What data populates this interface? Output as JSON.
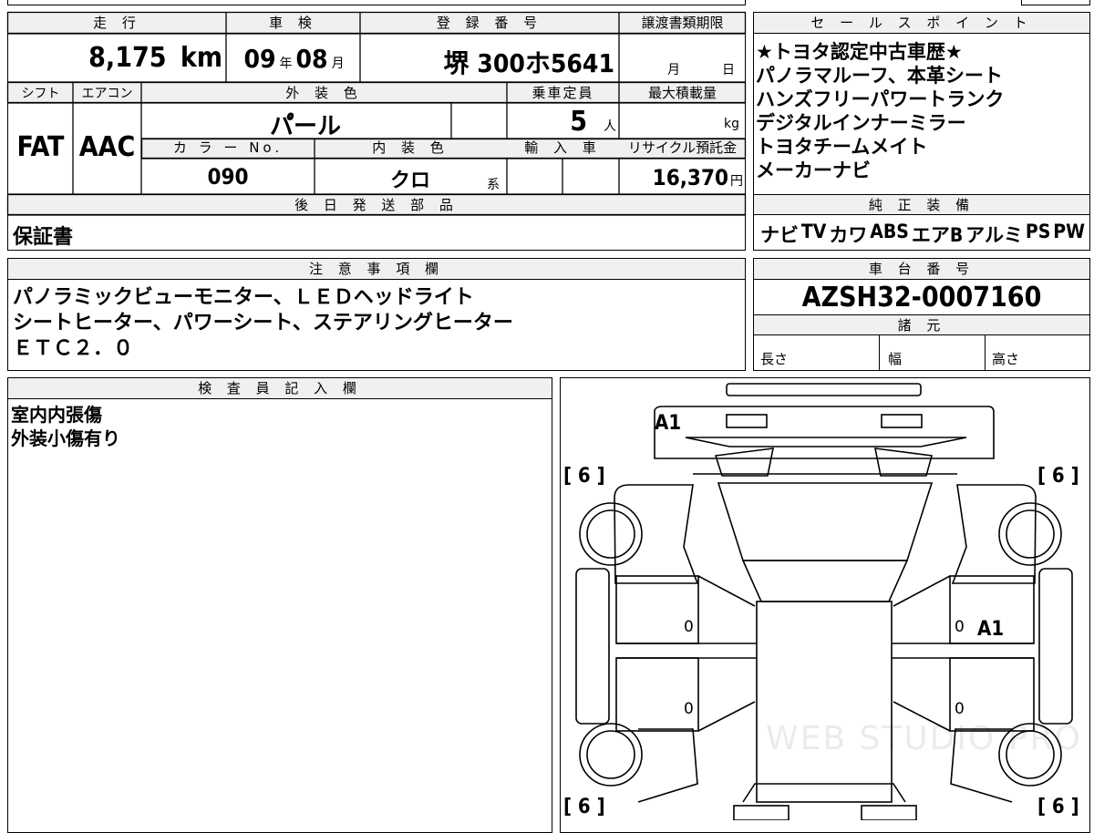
{
  "vehicle": {
    "odometer_label": "走 行",
    "odometer_value": "8,175",
    "odometer_unit": "km",
    "inspection_label": "車 検",
    "inspection_year": "09",
    "inspection_year_unit": "年",
    "inspection_month": "08",
    "inspection_month_unit": "月",
    "registration_label": "登 録 番 号",
    "registration_value": "堺 300ホ5641",
    "transfer_deadline_label": "譲渡書類期限",
    "transfer_month_unit": "月",
    "transfer_day_unit": "日",
    "shift_label": "シフト",
    "shift_value": "FAT",
    "aircon_label": "エアコン",
    "aircon_value": "AAC",
    "exterior_color_label": "外 装 色",
    "exterior_color_value": "パ゚ール",
    "capacity_label": "乗車定員",
    "capacity_value": "5",
    "capacity_unit": "人",
    "max_load_label": "最大積載量",
    "max_load_unit": "kg",
    "color_no_label": "カ ラ ー No.",
    "color_no_value": "090",
    "interior_color_label": "内 装 色",
    "interior_color_value": "クロ",
    "interior_color_suffix": "系",
    "import_label": "輸 入 車",
    "recycle_label": "リサイクル預託金",
    "recycle_value": "16,370",
    "recycle_unit": "円"
  },
  "later_parts": {
    "label": "後 日 発 送 部 品",
    "value": "保証書"
  },
  "sales_points": {
    "label": "セ ー ル ス ポ イ ン ト",
    "lines": [
      "★トヨタ認定中古車歴★",
      "パノラマルーフ、本革シート",
      "ハンズフリーパワートランク",
      "デジタルインナーミラー",
      "トヨタチームメイト",
      "メーカーナビ"
    ]
  },
  "equipment": {
    "label": "純 正 装 備",
    "items": [
      "ナビ",
      "TV",
      "カワ",
      "ABS",
      "エアB",
      "アルミ",
      "PS",
      "PW"
    ]
  },
  "notes": {
    "label": "注 意 事 項 欄",
    "lines": [
      "パノラミックビューモニター、ＬＥＤヘッドライト",
      "シートヒーター、パワーシート、ステアリングヒーター",
      "ＥＴＣ２．０"
    ]
  },
  "chassis": {
    "label": "車 台 番 号",
    "value": "AZSH32-0007160"
  },
  "specs": {
    "label": "諸 元",
    "length_label": "長さ",
    "width_label": "幅",
    "height_label": "高さ"
  },
  "inspector": {
    "label": "検 査 員 記 入 欄",
    "lines": [
      "室内内張傷",
      "外装小傷有り"
    ]
  },
  "diagram": {
    "marks": {
      "front_left_tire": "[ 6 ]",
      "front_right_tire": "[ 6 ]",
      "rear_left_tire": "[ 6 ]",
      "rear_right_tire": "[ 6 ]",
      "front_panel": "A1",
      "right_front_door": "A1",
      "door_zero": "0"
    },
    "watermark": "WEB STUDIO PRO"
  }
}
